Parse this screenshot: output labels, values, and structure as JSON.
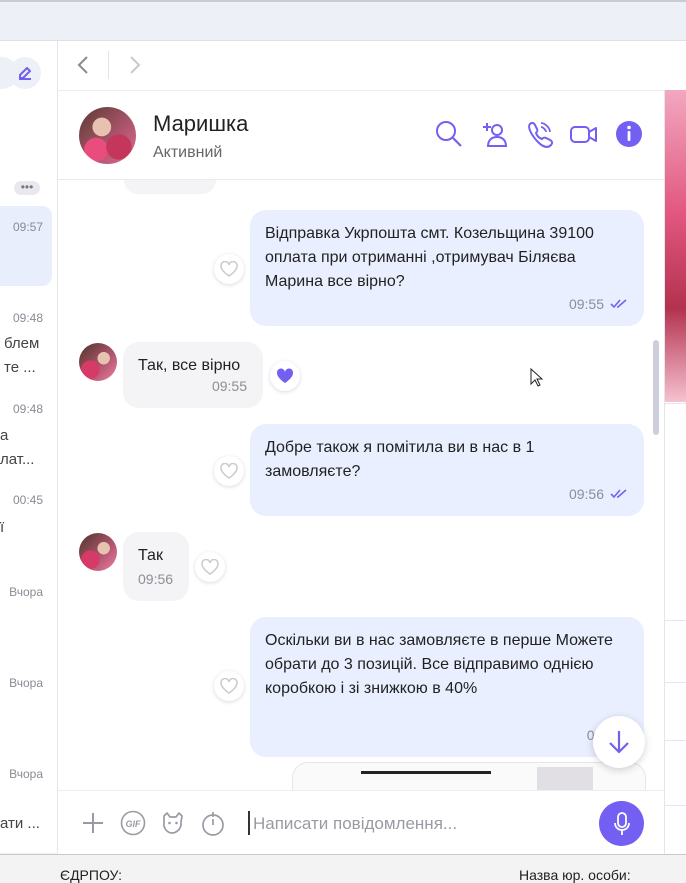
{
  "left_panel": {
    "items": [
      {
        "time": "09:57",
        "text": ""
      },
      {
        "time": "09:48",
        "text": "блем"
      },
      {
        "time": "",
        "text": "те ..."
      },
      {
        "time": "09:48",
        "text": "а"
      },
      {
        "time": "",
        "text": "лат..."
      },
      {
        "time": "00:45",
        "text": "ї"
      },
      {
        "time": "Вчора",
        "text": ""
      },
      {
        "time": "Вчора",
        "text": ""
      },
      {
        "time": "Вчора",
        "text": ""
      },
      {
        "time": "",
        "text": "ати ..."
      }
    ],
    "more_label": "•••"
  },
  "header": {
    "name": "Маришка",
    "status": "Активний"
  },
  "messages": [
    {
      "direction": "out",
      "text": "Відправка Укрпошта смт. Козельщина 39100 оплата при отриманні ,отримувач Біляєва Марина все вірно?",
      "time": "09:55"
    },
    {
      "direction": "in",
      "text": "Так, все вірно",
      "time": "09:55",
      "reaction": "liked"
    },
    {
      "direction": "out",
      "text": "Добре також я помітила ви в нас в 1 замовляєте?",
      "time": "09:56"
    },
    {
      "direction": "in",
      "text": "Так",
      "time": "09:56"
    },
    {
      "direction": "out",
      "text": "Оскільки ви в нас замовляєте в перше Можете обрати до 3 позицій. Все відправимо однією коробкою і зі знижкою в 40%",
      "time": "09:5"
    }
  ],
  "composer": {
    "placeholder": "Написати повідомлення..."
  },
  "bottom_bar": {
    "left_label": "ЄДРПОУ:",
    "right_label": "Назва юр. особи:"
  },
  "colors": {
    "accent": "#7360f2",
    "bubble_out": "#e9efff",
    "bubble_in": "#f4f4f6"
  },
  "icons": [
    "compose-icon",
    "back-arrow-icon",
    "forward-arrow-icon",
    "search-icon",
    "add-contact-icon",
    "phone-icon",
    "video-icon",
    "info-icon",
    "heart-icon",
    "double-check-icon",
    "plus-icon",
    "gif-icon",
    "sticker-icon",
    "timer-icon",
    "microphone-icon",
    "arrow-down-icon"
  ]
}
